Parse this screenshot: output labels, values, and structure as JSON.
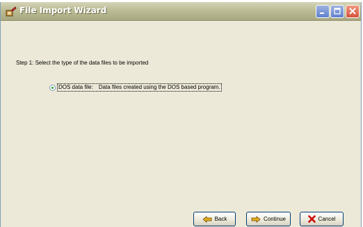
{
  "window": {
    "title": "File Import Wizard",
    "icons": {
      "app": "wizard-icon",
      "minimize": "minimize-icon",
      "maximize": "maximize-icon",
      "close": "close-icon"
    }
  },
  "content": {
    "step_text": "Step 1: Select the type of the data files to be imported",
    "option": {
      "name": "DOS data file:",
      "description": "Data files created using the DOS based program.",
      "selected": true
    }
  },
  "buttons": {
    "back": "Back",
    "continue": "Continue",
    "cancel": "Cancel"
  },
  "colors": {
    "titlebar": "#bcbc96",
    "dialog_bg": "#ece9d8",
    "radio_selected": "#21a121",
    "cancel_x": "#cc0000"
  }
}
